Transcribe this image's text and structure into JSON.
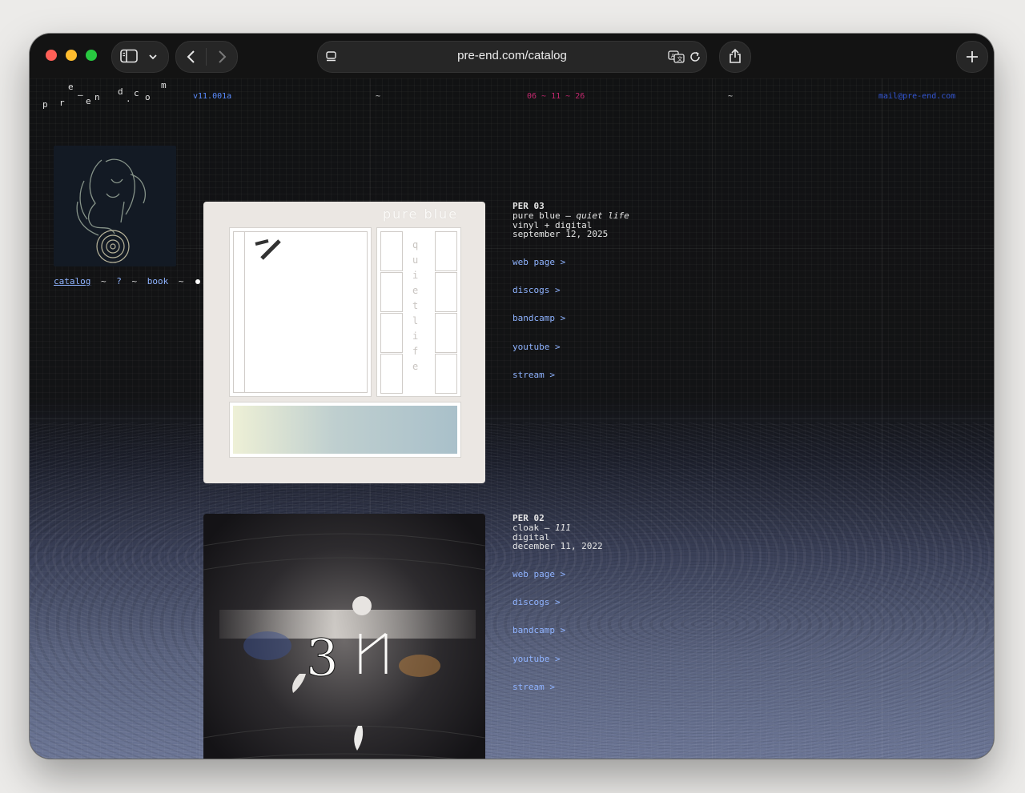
{
  "browser": {
    "url": "pre-end.com/catalog"
  },
  "site": {
    "logo_letters": [
      "p",
      "r",
      "e",
      "–",
      "e",
      "n",
      ".",
      "d",
      "c",
      "o",
      "m"
    ],
    "top_bar": {
      "version": "v11.001a",
      "tilde_left": "~",
      "date": "06 ~ 11 ~ 26",
      "tilde_right": "~",
      "email": "mail@pre-end.com"
    },
    "nav": {
      "catalog": "catalog",
      "sep1": "~",
      "question": "?",
      "sep2": "~",
      "book": "book",
      "sep3": "~"
    }
  },
  "releases": [
    {
      "catalog_no": "PER 03",
      "artist": "pure blue",
      "dash": "–",
      "title": "quiet life",
      "format": "vinyl + digital",
      "date": "september 12, 2025",
      "cover_text_top": "pure blue",
      "cover_text_side": "quiet life",
      "links": [
        "web page >",
        "discogs >",
        "bandcamp >",
        "youtube >",
        "stream >"
      ]
    },
    {
      "catalog_no": "PER 02",
      "artist": "cloak",
      "dash": "–",
      "title": "111",
      "format": "digital",
      "date": "december 11, 2022",
      "links": [
        "web page >",
        "discogs >",
        "bandcamp >",
        "youtube >",
        "stream >"
      ]
    }
  ],
  "colors": {
    "link": "#8fb3ff",
    "version": "#5a8cff",
    "date": "#c2286e",
    "email": "#3457d6"
  }
}
